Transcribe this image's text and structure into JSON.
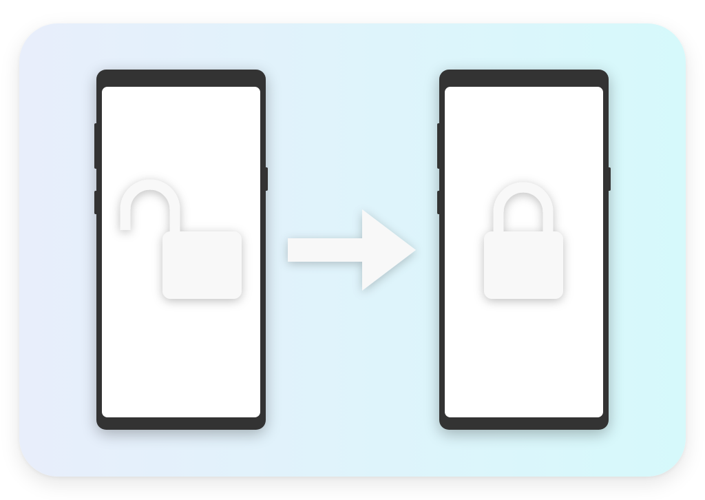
{
  "colors": {
    "card_gradient_start": "#e8eefb",
    "card_gradient_end": "#d6f9fb",
    "phone_body": "#333333",
    "phone_screen": "#ffffff",
    "symbol_fill": "#f8f8f8"
  },
  "phones": [
    {
      "state": "unlocked",
      "icon": "open-padlock-icon"
    },
    {
      "state": "locked",
      "icon": "closed-padlock-icon"
    }
  ],
  "transition": {
    "icon": "arrow-right-icon"
  }
}
